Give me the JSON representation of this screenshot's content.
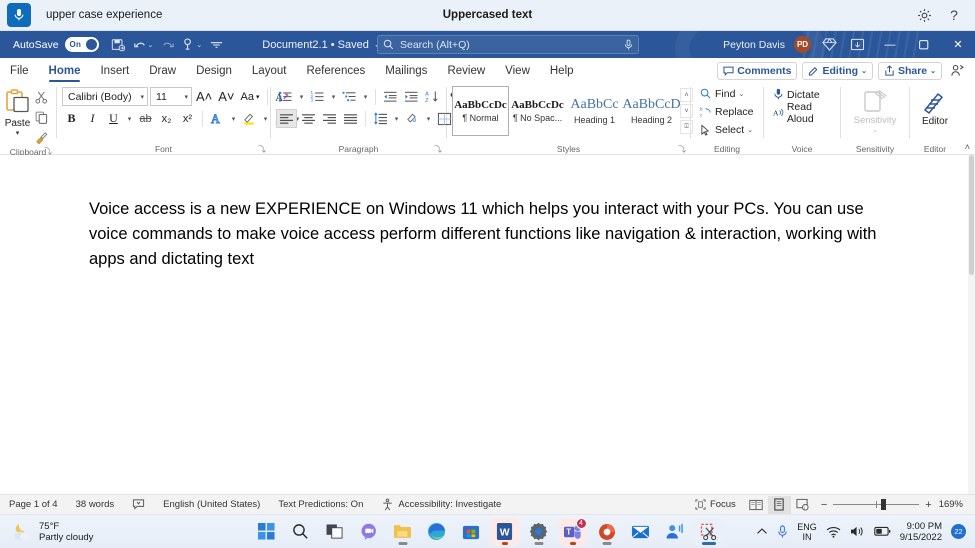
{
  "voice_access": {
    "mic_icon": "microphone-icon",
    "status_text": "upper case experience",
    "title": "Uppercased text",
    "settings_icon": "gear-icon",
    "help_icon": "question-mark-icon"
  },
  "titlebar": {
    "autosave_label": "AutoSave",
    "autosave_state": "On",
    "quick_access": [
      {
        "name": "save-button",
        "glyph": "💾"
      },
      {
        "name": "undo-button",
        "glyph": "↶",
        "caret": true
      },
      {
        "name": "redo-button",
        "glyph": "↻",
        "caret": false
      },
      {
        "name": "touch-mode-button",
        "glyph": "✋",
        "caret": true
      },
      {
        "name": "customize-quick-access-button",
        "glyph": "⌄",
        "caret": false
      }
    ],
    "document_name": "Document2.1 • Saved",
    "document_caret": "⌄",
    "search": {
      "icon": "search-icon",
      "placeholder": "Search (Alt+Q)",
      "mic_icon": "microphone-icon"
    },
    "user_name": "Peyton Davis",
    "user_initials": "PD",
    "diamond_icon": "diamond-icon",
    "ribbon_display_icon": "ribbon-display-options-icon",
    "window_controls": [
      {
        "name": "minimize-button",
        "glyph": "—"
      },
      {
        "name": "restore-button",
        "glyph": "❐"
      },
      {
        "name": "close-button",
        "glyph": "✕"
      }
    ]
  },
  "ribbon_tabs": {
    "tabs": [
      {
        "label": "File",
        "active": false
      },
      {
        "label": "Home",
        "active": true
      },
      {
        "label": "Insert",
        "active": false
      },
      {
        "label": "Draw",
        "active": false
      },
      {
        "label": "Design",
        "active": false
      },
      {
        "label": "Layout",
        "active": false
      },
      {
        "label": "References",
        "active": false
      },
      {
        "label": "Mailings",
        "active": false
      },
      {
        "label": "Review",
        "active": false
      },
      {
        "label": "View",
        "active": false
      },
      {
        "label": "Help",
        "active": false
      }
    ],
    "comments_label": "Comments",
    "editing_label": "Editing",
    "share_label": "Share",
    "present_icon": "present-in-teams-icon",
    "caret": "⌄"
  },
  "ribbon": {
    "clipboard": {
      "group_label": "Clipboard",
      "paste_label": "Paste",
      "paste_icon": "paste-icon",
      "cut_icon": "scissors-icon",
      "copy_icon": "copy-icon",
      "format_painter_icon": "format-painter-icon",
      "dialog_launcher": "⤵"
    },
    "font": {
      "group_label": "Font",
      "font_family": "Calibri (Body)",
      "font_size": "11",
      "grow_font": "A˄",
      "shrink_font": "A˅",
      "change_case": "Aa",
      "clear_formatting_icon": "clear-formatting-icon",
      "bold": "B",
      "italic": "I",
      "underline": "U",
      "strikethrough_icon": "strikethrough-icon",
      "subscript": "x₂",
      "superscript": "x²",
      "text_effects_icon": "text-effects-icon",
      "highlight_icon": "text-highlight-icon",
      "highlight_color": "#ffe600",
      "font_color_icon": "font-color-icon",
      "font_color": "#cc0000",
      "dialog_launcher": "⤵"
    },
    "paragraph": {
      "group_label": "Paragraph",
      "bullets_icon": "bullet-list-icon",
      "numbering_icon": "numbered-list-icon",
      "multilevel_icon": "multilevel-list-icon",
      "decrease_indent_icon": "decrease-indent-icon",
      "increase_indent_icon": "increase-indent-icon",
      "sort_icon": "sort-icon",
      "show_marks_icon": "paragraph-marks-icon",
      "align_left_icon": "align-left-icon",
      "align_center_icon": "align-center-icon",
      "align_right_icon": "align-right-icon",
      "justify_icon": "justify-icon",
      "line_spacing_icon": "line-spacing-icon",
      "shading_icon": "shading-icon",
      "borders_icon": "borders-icon",
      "dialog_launcher": "⤵"
    },
    "styles": {
      "group_label": "Styles",
      "items": [
        {
          "preview": "AaBbCcDc",
          "name": "¶ Normal",
          "heading": false,
          "selected": true
        },
        {
          "preview": "AaBbCcDc",
          "name": "¶ No Spac...",
          "heading": false,
          "selected": false
        },
        {
          "preview": "AaBbCс",
          "name": "Heading 1",
          "heading": true,
          "selected": false
        },
        {
          "preview": "AaBbCcD",
          "name": "Heading 2",
          "heading": true,
          "selected": false
        }
      ],
      "nav_up": "˄",
      "nav_down": "˅",
      "nav_more": "⍗",
      "dialog_launcher": "⤵"
    },
    "editing": {
      "group_label": "Editing",
      "find_label": "Find",
      "find_icon": "find-icon",
      "replace_label": "Replace",
      "replace_icon": "replace-icon",
      "select_label": "Select",
      "select_icon": "select-icon",
      "caret": "⌄"
    },
    "voice": {
      "group_label": "Voice",
      "dictate_label": "Dictate",
      "dictate_icon": "microphone-icon",
      "read_aloud_label": "Read Aloud",
      "read_aloud_icon": "read-aloud-icon"
    },
    "sensitivity": {
      "group_label": "Sensitivity",
      "label": "Sensitivity",
      "icon": "sensitivity-icon",
      "caret": "⌄"
    },
    "editor": {
      "group_label": "Editor",
      "label": "Editor",
      "icon": "editor-pen-icon"
    },
    "collapse_icon": "˄"
  },
  "document": {
    "body_text": "Voice access is a new EXPERIENCE on Windows 11 which helps you interact with your PCs. You can use voice commands to make voice access perform different functions like navigation & interaction, working with apps and dictating text"
  },
  "statusbar": {
    "page": "Page 1 of 4",
    "words": "38 words",
    "proofing_icon": "proofing-errors-icon",
    "language": "English (United States)",
    "text_predictions": "Text Predictions: On",
    "accessibility_icon": "accessibility-icon",
    "accessibility": "Accessibility: Investigate",
    "focus_label": "Focus",
    "focus_icon": "focus-mode-icon",
    "read_mode_icon": "read-mode-icon",
    "print_layout_icon": "print-layout-icon",
    "web_layout_icon": "web-layout-icon",
    "zoom_out": "−",
    "zoom_in": "+",
    "zoom_level": "169%"
  },
  "taskbar": {
    "weather": {
      "icon": "partly-cloudy-night-icon",
      "temperature": "75°F",
      "condition": "Partly cloudy"
    },
    "apps": [
      {
        "name": "start-button",
        "icon": "windows-logo-icon",
        "state": "none"
      },
      {
        "name": "search-button",
        "icon": "search-icon",
        "state": "none"
      },
      {
        "name": "task-view-button",
        "icon": "task-view-icon",
        "state": "none"
      },
      {
        "name": "chat-button",
        "icon": "chat-icon",
        "state": "none"
      },
      {
        "name": "file-explorer-button",
        "icon": "folder-icon",
        "state": "running"
      },
      {
        "name": "microsoft-edge-button",
        "icon": "edge-icon",
        "state": "none"
      },
      {
        "name": "microsoft-store-button",
        "icon": "store-icon",
        "state": "none"
      },
      {
        "name": "microsoft-word-button",
        "icon": "word-icon",
        "state": "active"
      },
      {
        "name": "settings-button",
        "icon": "gear-icon",
        "state": "running"
      },
      {
        "name": "microsoft-teams-button",
        "icon": "teams-icon",
        "state": "active",
        "badge": "4"
      },
      {
        "name": "powerpoint-button",
        "icon": "powerpoint-icon",
        "state": "running"
      },
      {
        "name": "mail-button",
        "icon": "mail-icon",
        "state": "none"
      },
      {
        "name": "voice-access-button",
        "icon": "voice-access-icon",
        "state": "none"
      },
      {
        "name": "snipping-tool-button",
        "icon": "snipping-tool-icon",
        "state": "focused"
      }
    ],
    "tray": {
      "overflow_icon": "chevron-up-icon",
      "mic_icon": "microphone-icon",
      "language_top": "ENG",
      "language_bottom": "IN",
      "wifi_icon": "wifi-icon",
      "volume_icon": "speaker-icon",
      "battery_icon": "battery-icon",
      "time": "9:00 PM",
      "date": "9/15/2022",
      "notification_count": "22"
    }
  }
}
